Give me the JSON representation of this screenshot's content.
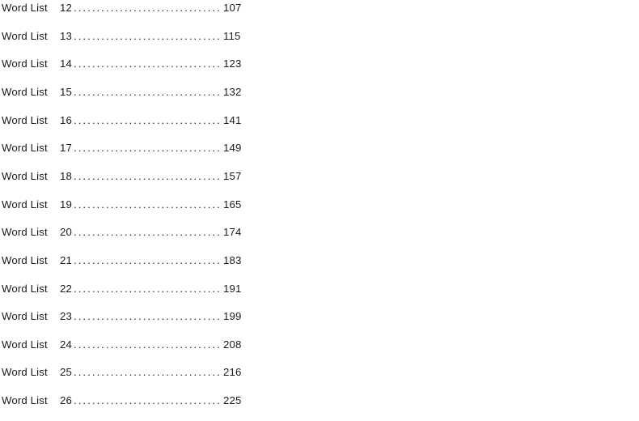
{
  "document": {
    "type": "table-of-contents",
    "background_color": "#ffffff",
    "text_color": "#1a1a1a",
    "leader_character": ".",
    "entries": [
      {
        "title": "Word List",
        "number": "12",
        "leader": "..................................................",
        "page": "107"
      },
      {
        "title": "Word List",
        "number": "13",
        "leader": "..................................................",
        "page": "115"
      },
      {
        "title": "Word List",
        "number": "14",
        "leader": "..................................................",
        "page": "123"
      },
      {
        "title": "Word List",
        "number": "15",
        "leader": "..................................................",
        "page": "132"
      },
      {
        "title": "Word List",
        "number": "16",
        "leader": "..................................................",
        "page": "141"
      },
      {
        "title": "Word List",
        "number": "17",
        "leader": "..................................................",
        "page": "149"
      },
      {
        "title": "Word List",
        "number": "18",
        "leader": "..................................................",
        "page": "157"
      },
      {
        "title": "Word List",
        "number": "19",
        "leader": "..................................................",
        "page": "165"
      },
      {
        "title": "Word List",
        "number": "20",
        "leader": "..................................................",
        "page": "174"
      },
      {
        "title": "Word List",
        "number": "21",
        "leader": "..................................................",
        "page": "183"
      },
      {
        "title": "Word List",
        "number": "22",
        "leader": "..................................................",
        "page": "191"
      },
      {
        "title": "Word List",
        "number": "23",
        "leader": "..................................................",
        "page": "199"
      },
      {
        "title": "Word List",
        "number": "24",
        "leader": "..................................................",
        "page": "208"
      },
      {
        "title": "Word List",
        "number": "25",
        "leader": "..................................................",
        "page": "216"
      },
      {
        "title": "Word List",
        "number": "26",
        "leader": "..................................................",
        "page": "225"
      }
    ]
  }
}
